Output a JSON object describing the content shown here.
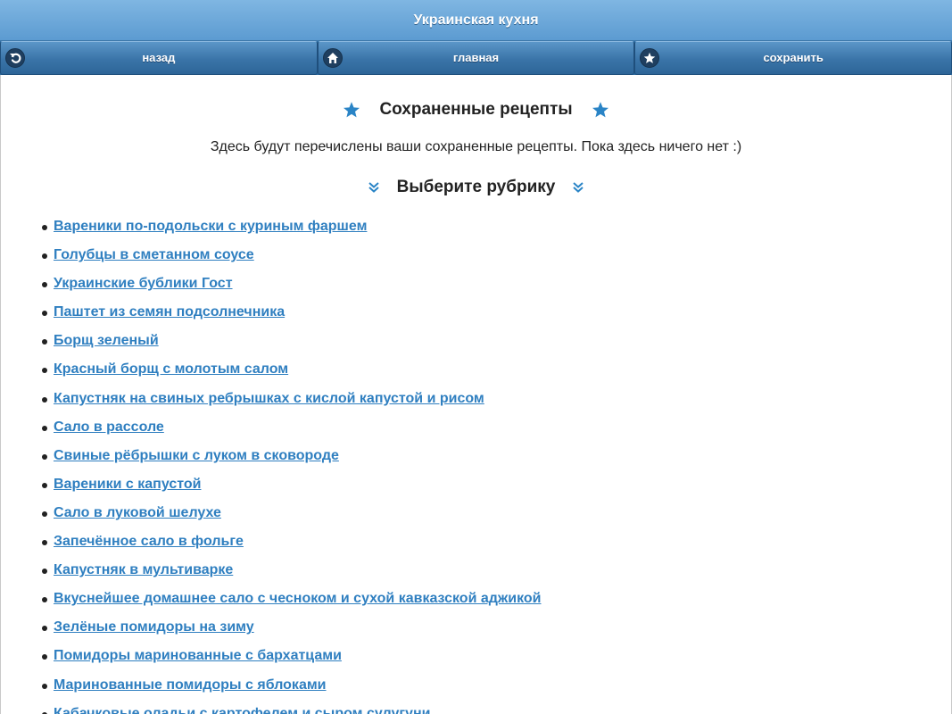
{
  "header": {
    "title": "Украинская кухня"
  },
  "nav": {
    "back_label": "назад",
    "home_label": "главная",
    "save_label": "сохранить"
  },
  "saved": {
    "title": "Сохраненные рецепты",
    "empty_text": "Здесь будут перечислены ваши сохраненные рецепты. Пока здесь ничего нет :)"
  },
  "categories": {
    "title": "Выберите рубрику"
  },
  "recipes": [
    "Вареники по-подольски с куриным фаршем",
    "Голубцы в сметанном соусе",
    "Украинские бублики Гост",
    "Паштет из семян подсолнечника",
    "Борщ зеленый",
    "Красный борщ с молотым салом",
    "Капустняк на свиных ребрышках с кислой капустой и рисом",
    "Сало в рассоле",
    "Свиные рёбрышки с луком в сковороде",
    "Вареники с капустой",
    "Сало в луковой шелухе",
    "Запечённое сало в фольге",
    "Капустняк в мультиварке",
    "Вкуснейшее домашнее сало с чесноком и сухой кавказской аджикой",
    "Зелёные помидоры на зиму",
    "Помидоры маринованные с бархатцами",
    "Маринованные помидоры с яблоками",
    "Кабачковые оладьи с картофелем и сыром сулугуни"
  ],
  "colors": {
    "link": "#2f7fc0",
    "accent": "#2a84c6",
    "header": "#6aa8db",
    "navbar": "#3a74a8"
  },
  "icons": {
    "back": "back-arrow-icon",
    "home": "home-icon",
    "save": "star-icon",
    "heading_decor": "star-icon",
    "category_decor": "double-chevron-down-icon"
  }
}
